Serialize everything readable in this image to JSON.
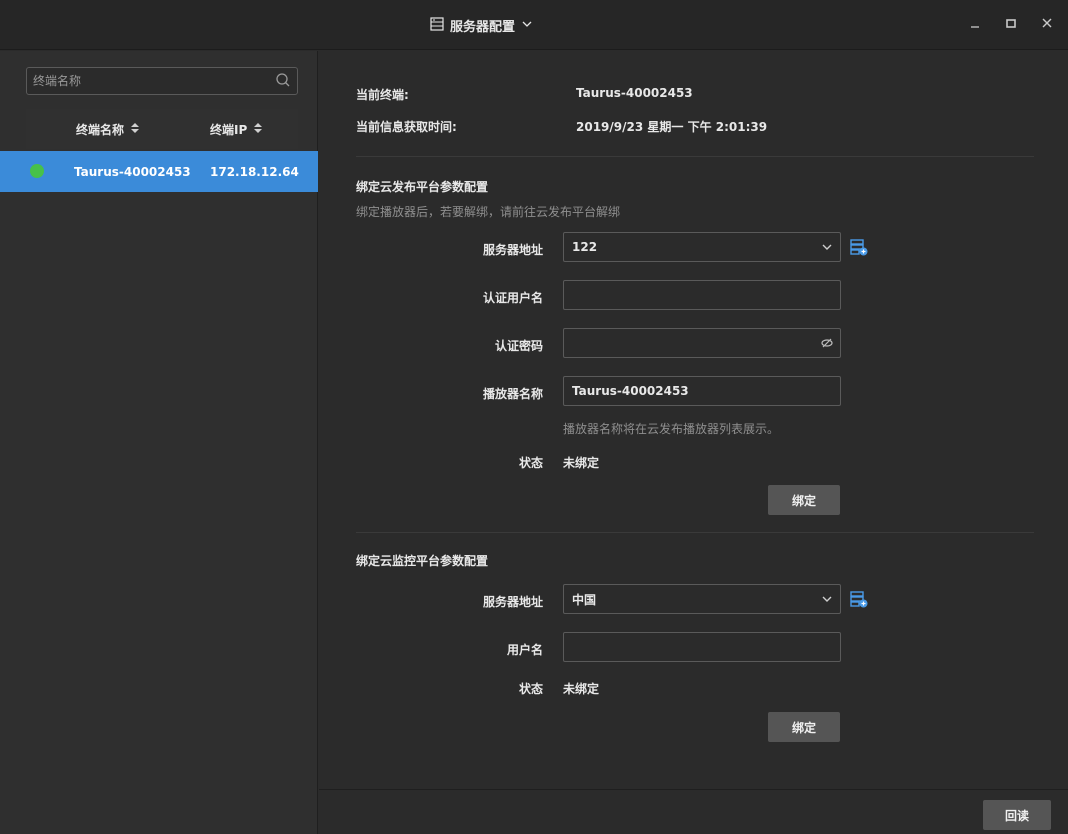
{
  "window": {
    "title": "服务器配置",
    "colors": {
      "bg": "#2b2b2b",
      "accent": "#3b8bd9",
      "online": "#47c14a"
    }
  },
  "left": {
    "search_placeholder": "终端名称",
    "columns": {
      "name": "终端名称",
      "ip": "终端IP"
    },
    "rows": [
      {
        "name": "Taurus-40002453",
        "ip": "172.18.12.64",
        "status": "online"
      }
    ]
  },
  "info": {
    "current_terminal_label": "当前终端:",
    "current_terminal_value": "Taurus-40002453",
    "fetch_time_label": "当前信息获取时间:",
    "fetch_time_value": "2019/9/23 星期一 下午 2:01:39"
  },
  "cloud_publish": {
    "title": "绑定云发布平台参数配置",
    "hint": "绑定播放器后，若要解绑，请前往云发布平台解绑",
    "server_label": "服务器地址",
    "server_value": "122",
    "user_label": "认证用户名",
    "user_value": "",
    "password_label": "认证密码",
    "password_value": "",
    "player_label": "播放器名称",
    "player_value": "Taurus-40002453",
    "player_hint": "播放器名称将在云发布播放器列表展示。",
    "status_label": "状态",
    "status_value": "未绑定",
    "bind_button": "绑定"
  },
  "cloud_monitor": {
    "title": "绑定云监控平台参数配置",
    "server_label": "服务器地址",
    "server_value": "中国",
    "user_label": "用户名",
    "user_value": "",
    "status_label": "状态",
    "status_value": "未绑定",
    "bind_button": "绑定"
  },
  "footer": {
    "readback_button": "回读"
  }
}
